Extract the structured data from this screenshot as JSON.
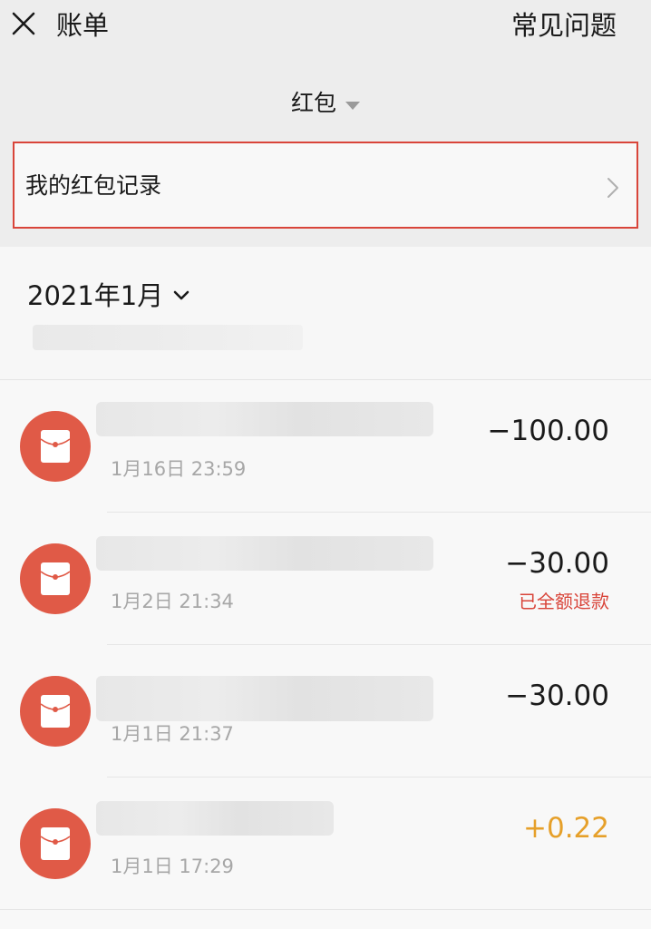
{
  "header": {
    "close_icon": "close-icon",
    "title": "账单",
    "faq_label": "常见问题"
  },
  "filter": {
    "selected": "红包",
    "dropdown_icon": "triangle-down-icon"
  },
  "records_row": {
    "label": "我的红包记录",
    "chevron_icon": "chevron-right-icon"
  },
  "month": {
    "label": "2021年1月",
    "chevron_icon": "chevron-down-icon"
  },
  "transactions": [
    {
      "time": "1月16日 23:59",
      "amount": "−100.00",
      "status": ""
    },
    {
      "time": "1月2日 21:34",
      "amount": "−30.00",
      "status": "已全额退款"
    },
    {
      "time": "1月1日 21:37",
      "amount": "−30.00",
      "status": ""
    },
    {
      "time": "1月1日 17:29",
      "amount": "+0.22",
      "status": ""
    }
  ],
  "colors": {
    "accent_red": "#d9453a",
    "avatar_red": "#e05a47",
    "income_orange": "#e6a02a"
  }
}
